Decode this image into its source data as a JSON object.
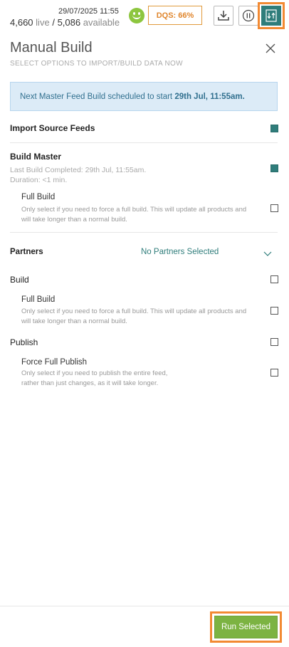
{
  "status": {
    "timestamp": "29/07/2025 11:55",
    "live_count": "4,660",
    "live_word": "live",
    "separator": "/",
    "available_count": "5,086",
    "available_word": "available",
    "dqs_label": "DQS: 66%"
  },
  "header": {
    "title": "Manual Build",
    "subtitle": "SELECT OPTIONS TO IMPORT/BUILD DATA NOW"
  },
  "notice": {
    "prefix": "Next Master Feed Build scheduled to start ",
    "highlight": "29th Jul, 11:55am."
  },
  "import_source": {
    "label": "Import Source Feeds",
    "checked": true
  },
  "build_master": {
    "label": "Build Master",
    "last_build": "Last Build Completed: 29th Jul, 11:55am.",
    "duration": "Duration: <1 min.",
    "checked": true,
    "full_build": {
      "label": "Full Build",
      "note_line1": "Only select if you need to force a full build. This will update all products and",
      "note_line2": "will take longer than a normal build.",
      "checked": false
    }
  },
  "partners": {
    "label": "Partners",
    "selected_value": "No Partners Selected",
    "build": {
      "label": "Build",
      "checked": false,
      "full_build": {
        "label": "Full Build",
        "note_line1": "Only select if you need to force a full build. This will update all products and",
        "note_line2": "will take longer than a normal build.",
        "checked": false
      }
    },
    "publish": {
      "label": "Publish",
      "checked": false,
      "force_full": {
        "label": "Force Full Publish",
        "note_line1": "Only select if you need to publish the entire feed,",
        "note_line2": "rather than just changes, as it will take longer.",
        "checked": false
      }
    }
  },
  "footer": {
    "run_label": "Run Selected"
  },
  "colors": {
    "teal": "#2f7d7b",
    "orange_highlight": "#f28a33",
    "green_button": "#7cb342",
    "smiley_green": "#8dc63f",
    "notice_bg": "#dcebf7"
  },
  "icons": [
    "smiley-icon",
    "download-icon",
    "pause-icon",
    "sync-icon",
    "close-icon",
    "chevron-down-icon"
  ]
}
